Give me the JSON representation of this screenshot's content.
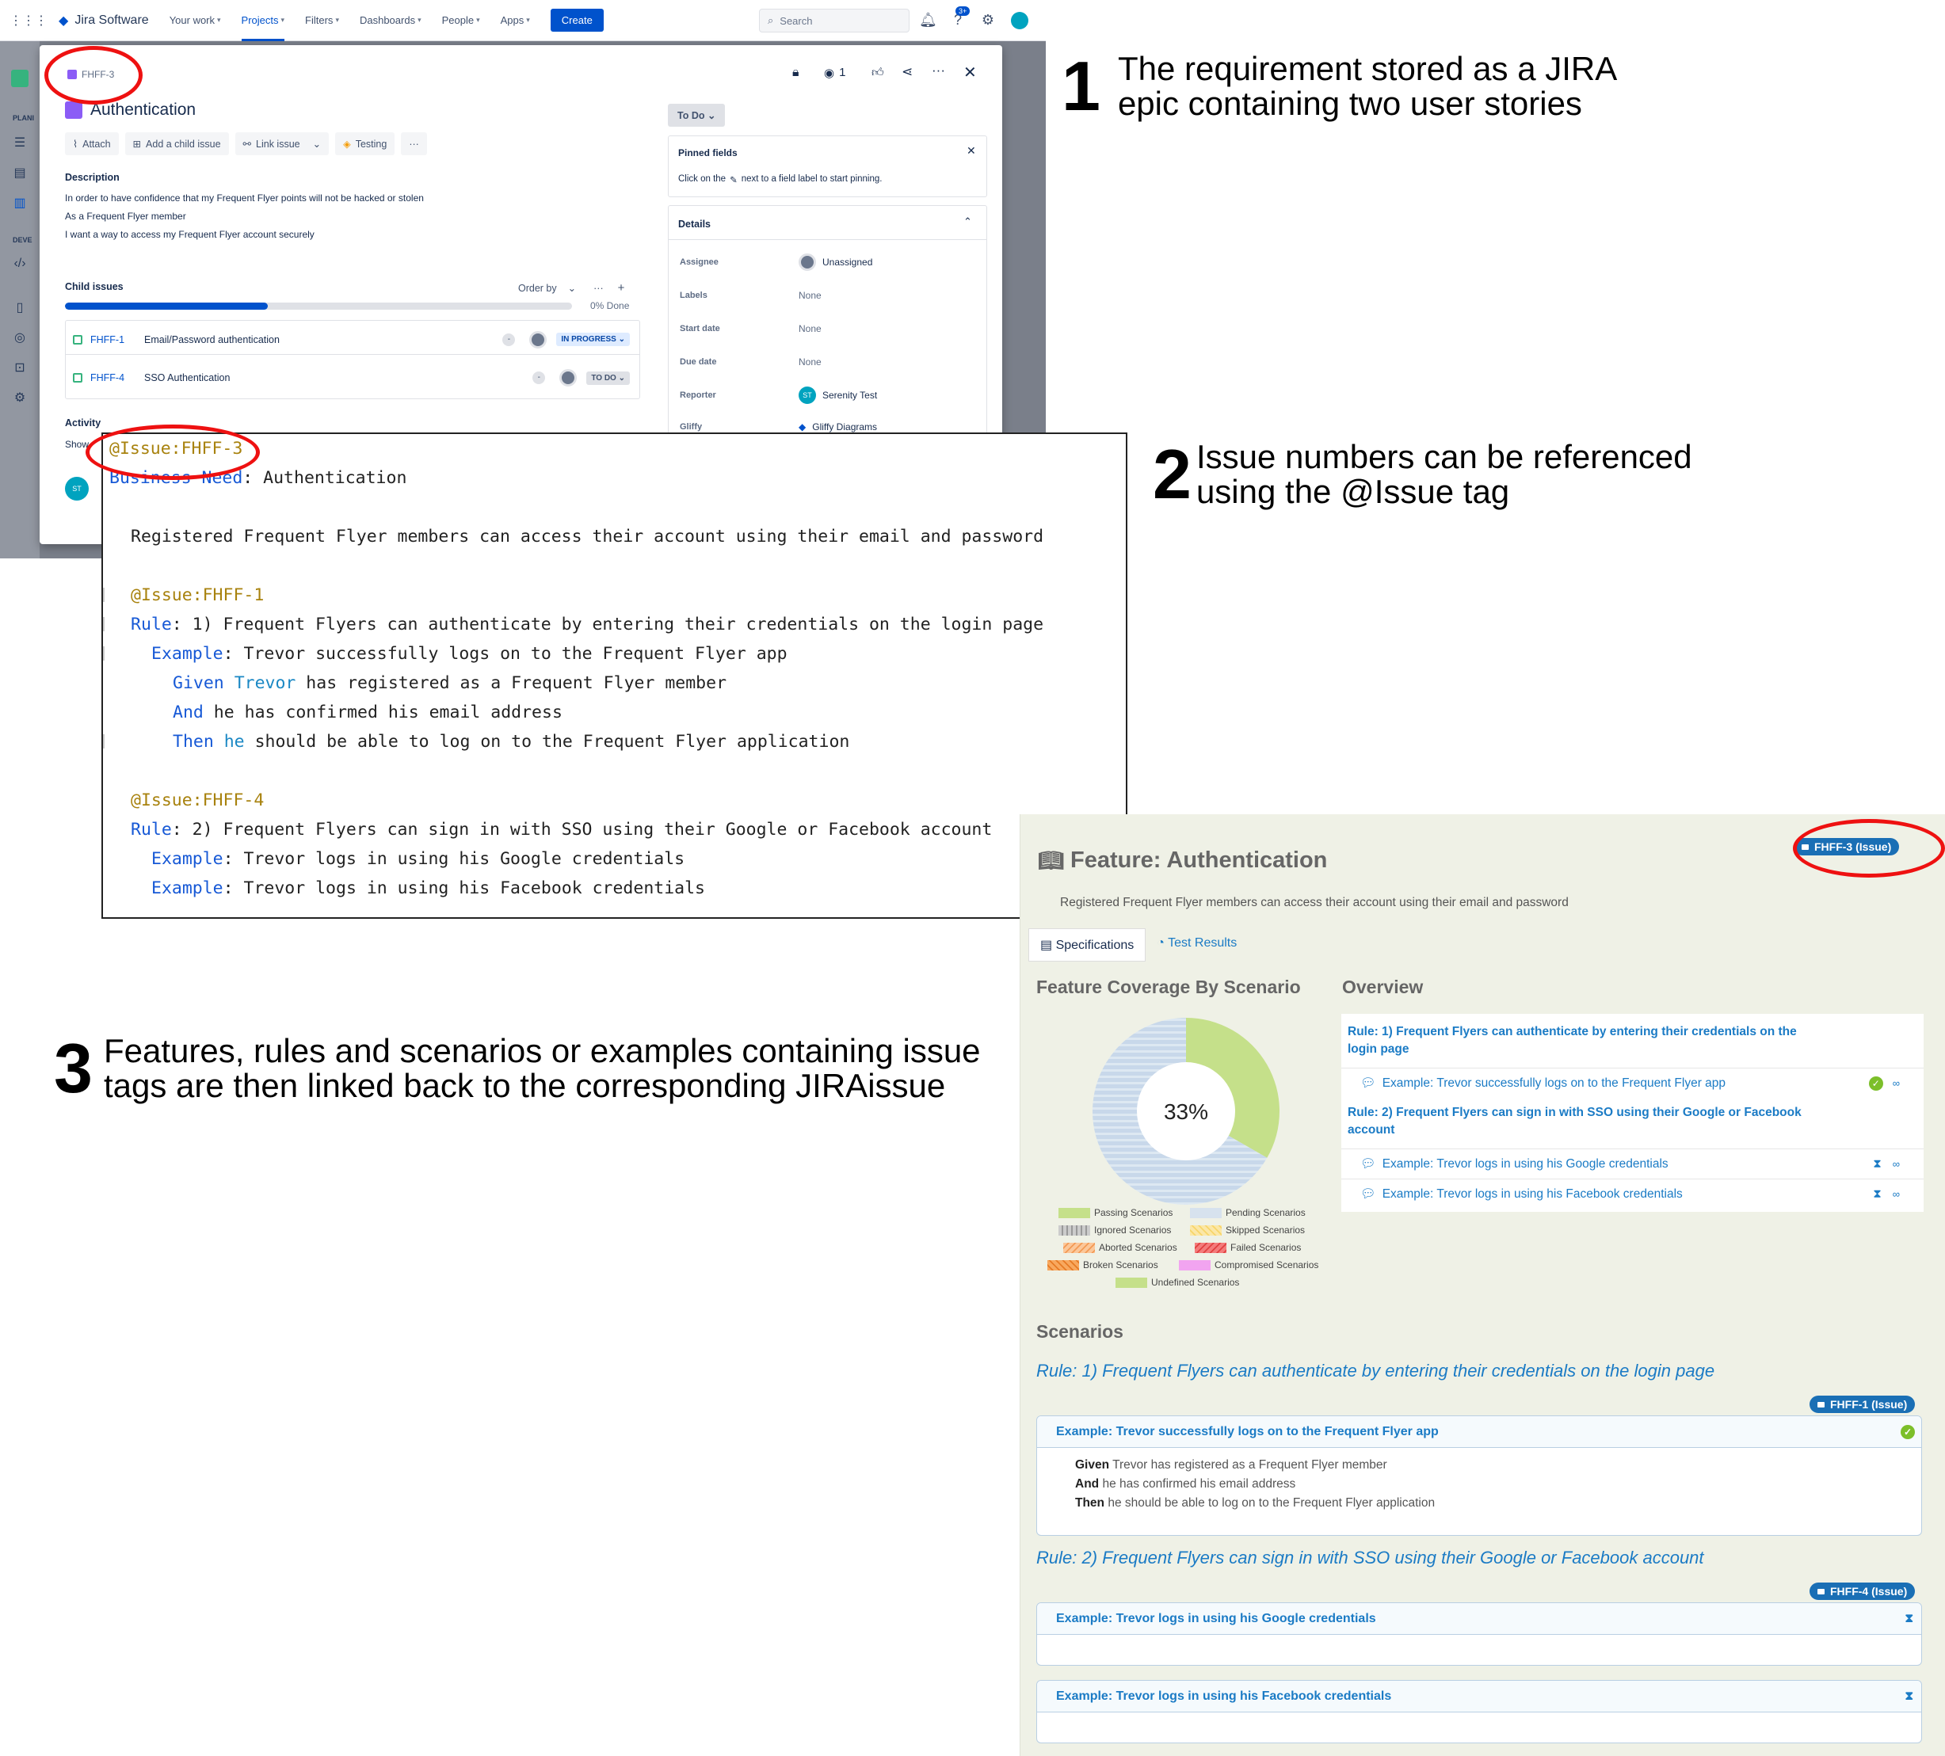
{
  "jira": {
    "product": "Jira Software",
    "nav": [
      "Your work",
      "Projects",
      "Filters",
      "Dashboards",
      "People",
      "Apps"
    ],
    "create": "Create",
    "search_placeholder": "Search",
    "notif_badge": "3+",
    "rail_labels": [
      "PLANI",
      "DEVE"
    ],
    "issue_key": "FHFF-3",
    "watch_count": "1",
    "title": "Authentication",
    "toolbar": {
      "attach": "Attach",
      "add_child": "Add a child issue",
      "link": "Link issue",
      "testing": "Testing"
    },
    "description_label": "Description",
    "description": [
      "In order to have confidence that my Frequent Flyer points will not be hacked or stolen",
      "As a Frequent Flyer member",
      "I want a way to access my Frequent Flyer account securely"
    ],
    "child_issues_label": "Child issues",
    "order_by": "Order by",
    "progress_done": 0,
    "progress_text": "0% Done",
    "children": [
      {
        "key": "FHFF-1",
        "summary": "Email/Password authentication",
        "status": "IN PROGRESS"
      },
      {
        "key": "FHFF-4",
        "summary": "SSO Authentication",
        "status": "TO DO"
      }
    ],
    "activity": "Activity",
    "show": "Show",
    "status_btn": "To Do",
    "pinned_title": "Pinned fields",
    "pinned_hint": "Click on the",
    "pinned_hint2": "next to a field label to start pinning.",
    "details_title": "Details",
    "details": [
      {
        "label": "Assignee",
        "value": "Unassigned"
      },
      {
        "label": "Labels",
        "value": "None"
      },
      {
        "label": "Start date",
        "value": "None"
      },
      {
        "label": "Due date",
        "value": "None"
      },
      {
        "label": "Reporter",
        "value": "Serenity Test"
      },
      {
        "label": "Gliffy",
        "value": "Gliffy Diagrams"
      }
    ],
    "reporter_initials": "ST"
  },
  "code": {
    "l1": "@Issue:FHFF-3",
    "l2_kw": "Business Need",
    "l2_rest": ": Authentication",
    "l3": "Registered Frequent Flyer members can access their account using their email and password",
    "l4": "@Issue:FHFF-1",
    "l5_kw": "Rule",
    "l5_rest": ": 1) Frequent Flyers can authenticate by entering their credentials on the login page",
    "l6_kw": "Example",
    "l6_rest": ": Trevor successfully logs on to the Frequent Flyer app",
    "l7_kw": "Given",
    "l7_var": "Trevor",
    "l7_rest": " has registered as a Frequent Flyer member",
    "l8_kw": "And",
    "l8_rest": " he has confirmed his email address",
    "l9_kw": "Then",
    "l9_var": "he",
    "l9_rest": " should be able to log on to the Frequent Flyer application",
    "l10": "@Issue:FHFF-4",
    "l11_kw": "Rule",
    "l11_rest": ": 2) Frequent Flyers can sign in with SSO using their Google or Facebook account",
    "l12_kw": "Example",
    "l12_rest": ": Trevor logs in using his Google credentials",
    "l13_kw": "Example",
    "l13_rest": ": Trevor logs in using his Facebook credentials"
  },
  "annotations": [
    {
      "num": "1",
      "text1": "The requirement stored as a JIRA",
      "text2": "epic containing two user stories"
    },
    {
      "num": "2",
      "text1": "Issue numbers can be referenced",
      "text2": "using the @Issue tag"
    },
    {
      "num": "3",
      "text1": "Features, rules and scenarios or examples containing issue",
      "text2": "tags are then linked back to the corresponding JIRAissue"
    }
  ],
  "serenity": {
    "feature_title": "Feature: Authentication",
    "feature_tag": "FHFF-3 (Issue)",
    "narrative": "Registered Frequent Flyer members can access their account using their email and password",
    "tabs": [
      "Specifications",
      "Test Results"
    ],
    "coverage_title": "Feature Coverage By Scenario",
    "overview_title": "Overview",
    "pie_percent": "33%",
    "pie_passing_fraction": 0.333,
    "legend": [
      "Passing Scenarios",
      "Pending Scenarios",
      "Ignored Scenarios",
      "Skipped Scenarios",
      "Aborted Scenarios",
      "Failed Scenarios",
      "Broken Scenarios",
      "Compromised Scenarios",
      "Undefined Scenarios"
    ],
    "overview": {
      "rule1": "Rule: 1) Frequent Flyers can authenticate by entering their credentials on the login page",
      "ex1": "Example: Trevor successfully logs on to the Frequent Flyer app",
      "rule2": "Rule: 2) Frequent Flyers can sign in with SSO using their Google or Facebook account",
      "ex2": "Example: Trevor logs in using his Google credentials",
      "ex3": "Example: Trevor logs in using his Facebook credentials"
    },
    "scenarios_title": "Scenarios",
    "rule1_title": "Rule: 1) Frequent Flyers can authenticate by entering their credentials on the login page",
    "rule1_tag": "FHFF-1 (Issue)",
    "scenario1": "Example: Trevor successfully logs on to the Frequent Flyer app",
    "steps": [
      {
        "kw": "Given",
        "text": " Trevor has registered as a Frequent Flyer member"
      },
      {
        "kw": "And",
        "text": " he has confirmed his email address"
      },
      {
        "kw": "Then",
        "text": " he should be able to log on to the Frequent Flyer application"
      }
    ],
    "rule2_title": "Rule: 2) Frequent Flyers can sign in with SSO using their Google or Facebook account",
    "rule2_tag": "FHFF-4 (Issue)",
    "scenario2": "Example: Trevor logs in using his Google credentials",
    "scenario3": "Example: Trevor logs in using his Facebook credentials"
  },
  "colors": {
    "jira_blue": "#0052cc",
    "serenity_blue": "#1b7bc5",
    "passing": "#c5e08a",
    "pending": "#c8d8ea",
    "highlight_red": "#e11"
  }
}
